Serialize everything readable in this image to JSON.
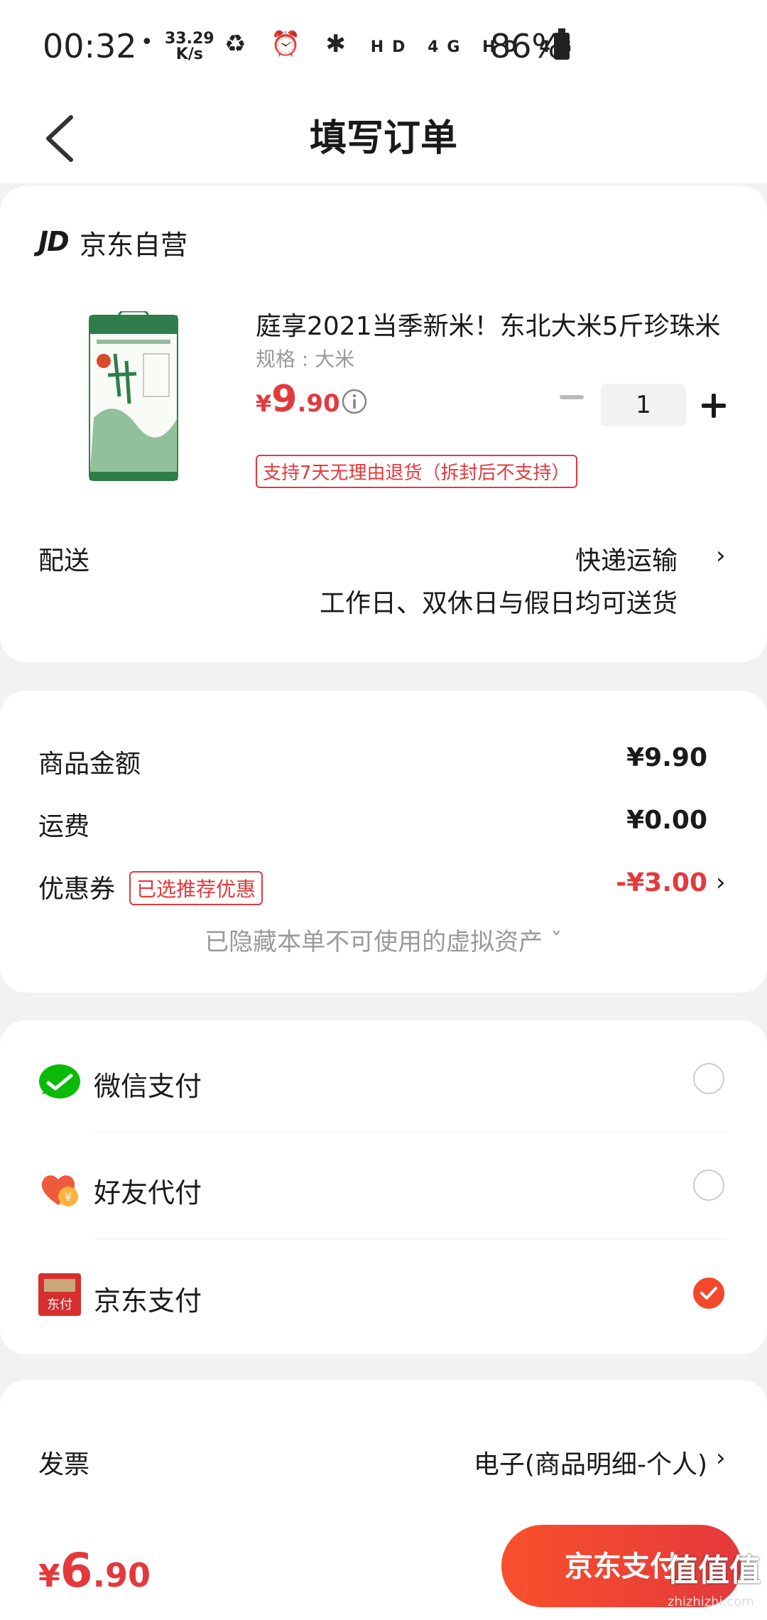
{
  "status_bar": {
    "time": "00:32",
    "dot": "•",
    "speed_value": "33.29",
    "speed_unit": "K/s",
    "network": "HD 4G HD 4G",
    "battery": "86%"
  },
  "header": {
    "title": "填写订单"
  },
  "shop": {
    "logo_text": "JD",
    "name": "京东自营"
  },
  "product": {
    "title": "庭享2021当季新米！东北大米5斤珍珠米",
    "spec": "规格 : 大米",
    "price_symbol": "¥",
    "price_int": "9",
    "price_dec": ".90",
    "quantity": "1",
    "return_policy": "支持7天无理由退货（拆封后不支持）"
  },
  "delivery": {
    "label": "配送",
    "method": "快递运输",
    "description": "工作日、双休日与假日均可送货"
  },
  "summary": {
    "goods_label": "商品金额",
    "goods_amount": "¥9.90",
    "shipping_label": "运费",
    "shipping_amount": "¥0.00",
    "coupon_label": "优惠券",
    "coupon_tag": "已选推荐优惠",
    "coupon_amount": "-¥3.00",
    "hidden_assets": "已隐藏本单不可使用的虚拟资产 ˇ"
  },
  "payment": {
    "options": [
      {
        "label": "微信支付",
        "icon": "wechat-pay-icon",
        "selected": false
      },
      {
        "label": "好友代付",
        "icon": "friend-pay-icon",
        "selected": false
      },
      {
        "label": "京东支付",
        "icon": "jd-pay-icon",
        "selected": true
      }
    ],
    "jd_icon_text": "东付"
  },
  "invoice": {
    "label": "发票",
    "value": "电子(商品明细-个人)"
  },
  "bottom": {
    "total_symbol": "¥",
    "total_int": "6",
    "total_dec": ".90",
    "pay_button": "京东支付",
    "watermark": "值值值",
    "watermark_url": "zhizhizhi.com"
  },
  "colors": {
    "accent_red": "#e4393c",
    "wechat_green": "#09bb07",
    "pay_orange": "#f2492c"
  }
}
